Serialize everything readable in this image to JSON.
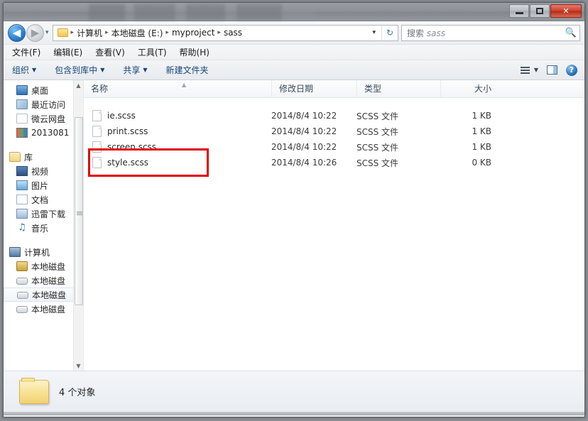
{
  "window": {
    "title": "",
    "controls": {
      "minimize": "–",
      "maximize": "□",
      "close": "✕"
    }
  },
  "address": {
    "back_icon": "◀",
    "forward_icon": "▶",
    "recent_dropdown_icon": "▾",
    "folder_icon": "folder-icon",
    "separator": "▸",
    "crumbs": [
      "计算机",
      "本地磁盘 (E:)",
      "myproject",
      "sass"
    ],
    "history_dropdown_icon": "▾",
    "refresh_icon": "↻"
  },
  "search": {
    "placeholder_lead": "搜索",
    "placeholder_value": "sass",
    "icon": "search-icon"
  },
  "menubar": {
    "items": [
      "文件(F)",
      "编辑(E)",
      "查看(V)",
      "工具(T)",
      "帮助(H)"
    ]
  },
  "toolbar": {
    "buttons": [
      {
        "label": "组织",
        "has_caret": true
      },
      {
        "label": "包含到库中",
        "has_caret": true
      },
      {
        "label": "共享",
        "has_caret": true
      },
      {
        "label": "新建文件夹",
        "has_caret": false
      }
    ],
    "caret": "▼",
    "view_icon": "view-layout-icon",
    "preview_icon": "preview-pane-icon",
    "help_icon": "?"
  },
  "sidebar": {
    "items": [
      {
        "label": "桌面",
        "icon": "desktop-icon",
        "type": "item",
        "icon_class": "ico-desktop"
      },
      {
        "label": "最近访问",
        "icon": "recent-places-icon",
        "type": "item",
        "icon_class": "ico-recent"
      },
      {
        "label": "微云网盘",
        "icon": "cloud-drive-icon",
        "type": "item",
        "icon_class": "ico-page"
      },
      {
        "label": "2013081",
        "icon": "books-icon",
        "type": "item",
        "icon_class": "ico-books"
      },
      {
        "label": "库",
        "icon": "libraries-icon",
        "type": "group",
        "icon_class": "ico-lib"
      },
      {
        "label": "视频",
        "icon": "video-icon",
        "type": "item",
        "icon_class": "ico-video"
      },
      {
        "label": "图片",
        "icon": "pictures-icon",
        "type": "item",
        "icon_class": "ico-pic"
      },
      {
        "label": "文档",
        "icon": "documents-icon",
        "type": "item",
        "icon_class": "ico-doc"
      },
      {
        "label": "迅雷下载",
        "icon": "downloads-icon",
        "type": "item",
        "icon_class": "ico-dl"
      },
      {
        "label": "音乐",
        "icon": "music-icon",
        "type": "item",
        "icon_class": "ico-music"
      },
      {
        "label": "计算机",
        "icon": "computer-icon",
        "type": "group",
        "icon_class": "ico-pc"
      },
      {
        "label": "本地磁盘",
        "icon": "system-disk-icon",
        "type": "item",
        "icon_class": "ico-disk-sys"
      },
      {
        "label": "本地磁盘",
        "icon": "disk-icon",
        "type": "item",
        "icon_class": "ico-disk"
      },
      {
        "label": "本地磁盘",
        "icon": "disk-icon",
        "type": "item",
        "icon_class": "ico-disk",
        "selected": true
      },
      {
        "label": "本地磁盘",
        "icon": "disk-icon",
        "type": "item",
        "icon_class": "ico-disk"
      }
    ],
    "scroll_up_icon": "▲",
    "scroll_down_icon": "▼"
  },
  "filelist": {
    "columns": [
      "名称",
      "修改日期",
      "类型",
      "大小"
    ],
    "sort_indicator": "▲",
    "rows": [
      {
        "name": "ie.scss",
        "date": "2014/8/4 10:22",
        "type": "SCSS 文件",
        "size": "1 KB"
      },
      {
        "name": "print.scss",
        "date": "2014/8/4 10:22",
        "type": "SCSS 文件",
        "size": "1 KB"
      },
      {
        "name": "screen.scss",
        "date": "2014/8/4 10:22",
        "type": "SCSS 文件",
        "size": "1 KB"
      },
      {
        "name": "style.scss",
        "date": "2014/8/4 10:26",
        "type": "SCSS 文件",
        "size": "0 KB"
      }
    ]
  },
  "annotation": {
    "color": "#e10000",
    "target": "style.scss"
  },
  "statusbar": {
    "text": "4 个对象",
    "icon": "folder-icon"
  }
}
